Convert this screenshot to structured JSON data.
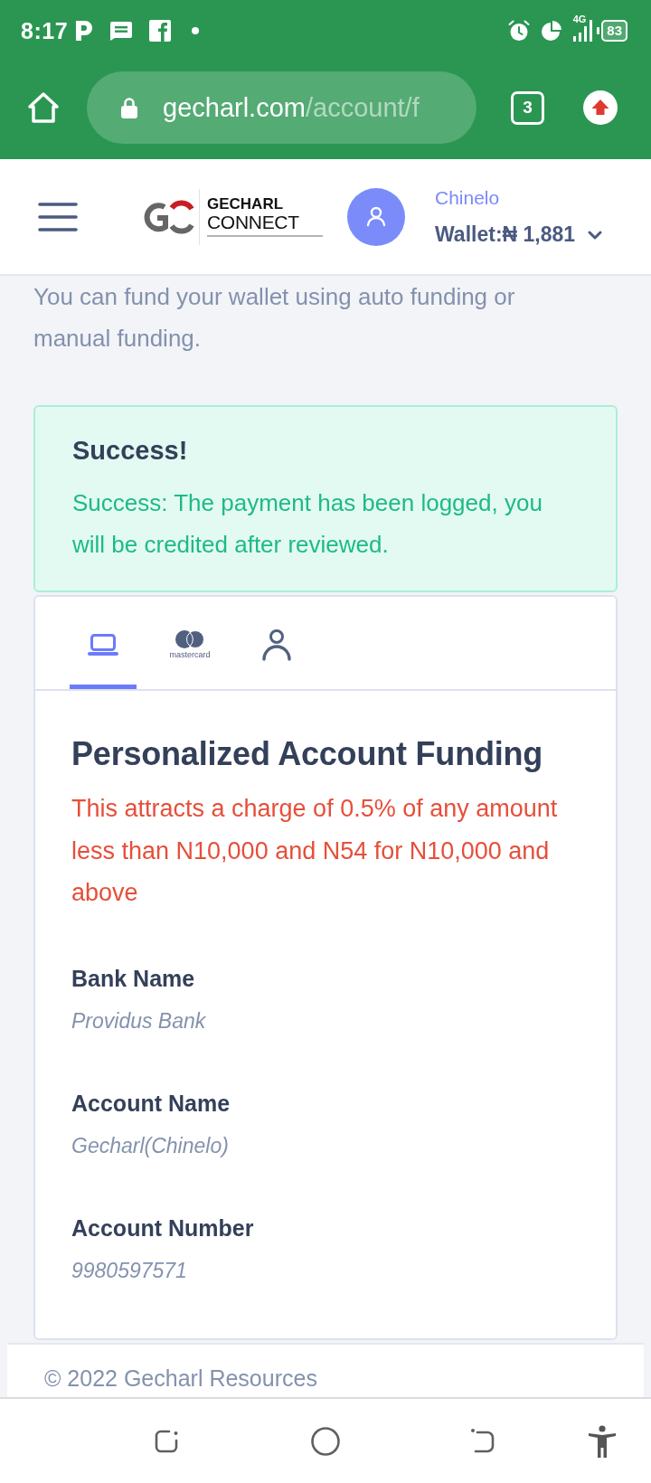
{
  "status_bar": {
    "time": "8:17",
    "network": "4G",
    "battery": "83"
  },
  "browser": {
    "url_host": "gecharl.com",
    "url_path": "/account/f",
    "tab_count": "3"
  },
  "header": {
    "logo": {
      "name": "GECHARL",
      "subname": "CONNECT"
    },
    "user_name": "Chinelo",
    "wallet": "Wallet:₦ 1,881"
  },
  "intro": "You can fund your wallet using auto funding or manual funding.",
  "alert": {
    "title": "Success!",
    "message": "Success: The payment has been logged, you will be credited after reviewed."
  },
  "funding_card": {
    "tabs": [
      {
        "kind": "laptop",
        "selected": true
      },
      {
        "kind": "card",
        "label": "mastercard",
        "selected": false
      },
      {
        "kind": "person",
        "selected": false
      }
    ],
    "title": "Personalized Account Funding",
    "note": "This attracts a charge of 0.5% of any amount less than N10,000 and N54 for N10,000 and above",
    "fields": [
      {
        "label": "Bank Name",
        "value": "Providus Bank"
      },
      {
        "label": "Account Name",
        "value": "Gecharl(Chinelo)"
      },
      {
        "label": "Account Number",
        "value": "9980597571"
      }
    ]
  },
  "footer": {
    "copyright": "© 2022 Gecharl Resources"
  }
}
